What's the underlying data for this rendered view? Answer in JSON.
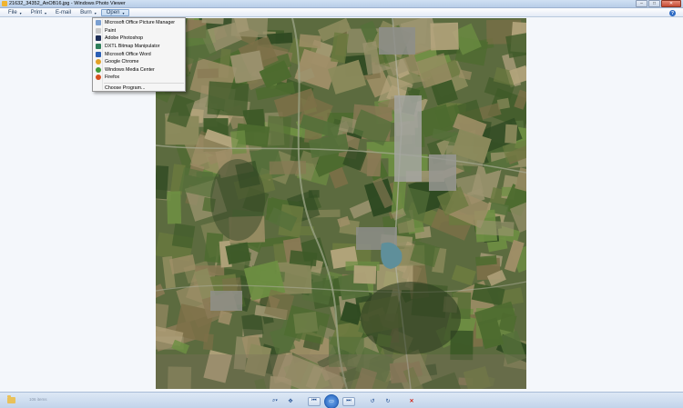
{
  "window": {
    "title": "21632_34352_AnOB16.jpg - Windows Photo Viewer",
    "buttons": {
      "minimize": "–",
      "maximize": "□",
      "close": "✕"
    }
  },
  "menubar": {
    "items": [
      {
        "label": "File",
        "caret": "▾"
      },
      {
        "label": "Print",
        "caret": "▾"
      },
      {
        "label": "E-mail",
        "caret": ""
      },
      {
        "label": "Burn",
        "caret": "▾"
      },
      {
        "label": "Open",
        "caret": "▾"
      }
    ],
    "help_glyph": "?"
  },
  "open_menu": {
    "items": [
      {
        "label": "Microsoft Office Picture Manager",
        "icon": "picture-manager-icon",
        "color": "#7a9fd1"
      },
      {
        "label": "Paint",
        "icon": "paint-icon",
        "color": "#c9c9c9"
      },
      {
        "label": "Adobe Photoshop",
        "icon": "photoshop-icon",
        "color": "#1f2f57"
      },
      {
        "label": "DXTL Bitmap Manipulator",
        "icon": "bitmap-manipulator-icon",
        "color": "#2f7f5a"
      },
      {
        "label": "Microsoft Office Word",
        "icon": "word-icon",
        "color": "#2b5fb4"
      },
      {
        "label": "Google Chrome",
        "icon": "chrome-icon",
        "color": "#e2a126"
      },
      {
        "label": "Windows Media Center",
        "icon": "media-center-icon",
        "color": "#3f9a3a"
      },
      {
        "label": "Firefox",
        "icon": "firefox-icon",
        "color": "#d7501f"
      }
    ],
    "choose_program": "Choose Program..."
  },
  "statusbar": {
    "item_count": "106 items",
    "controls": {
      "zoom": "⌕▾",
      "fit": "✥",
      "previous": "⏮",
      "slideshow": "▭",
      "next": "⏭",
      "rotate_ccw": "↺",
      "rotate_cw": "↻",
      "delete": "✕"
    }
  },
  "colors": {
    "accent": "#2d6bc4",
    "viewer_background": "#f4f7fb",
    "delete": "#d0271b"
  }
}
